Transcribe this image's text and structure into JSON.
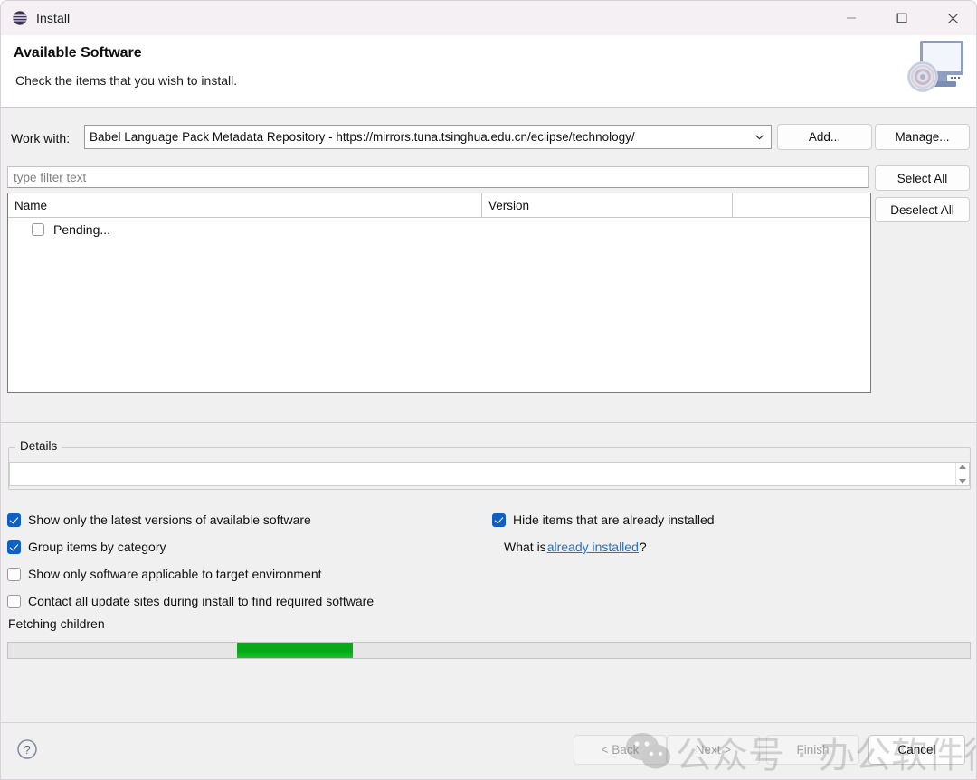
{
  "window": {
    "title": "Install",
    "icon": "eclipse-globe-icon",
    "controls": {
      "minimize": "minimize-icon",
      "maximize": "maximize-icon",
      "close": "close-icon"
    }
  },
  "header": {
    "title": "Available Software",
    "subtitle": "Check the items that you wish to install.",
    "icon": "monitor-disc-icon"
  },
  "workwith": {
    "label": "Work with:",
    "value": "Babel Language Pack Metadata Repository - https://mirrors.tuna.tsinghua.edu.cn/eclipse/technology/",
    "add_label": "Add...",
    "manage_label": "Manage..."
  },
  "filter": {
    "placeholder": "type filter text",
    "value": ""
  },
  "list_buttons": {
    "select_all": "Select All",
    "deselect_all": "Deselect All"
  },
  "table": {
    "columns": [
      "Name",
      "Version",
      ""
    ],
    "rows": [
      {
        "name": "Pending...",
        "version": "",
        "checked": false
      }
    ]
  },
  "details": {
    "legend": "Details",
    "text": ""
  },
  "options": {
    "latest_versions": {
      "label": "Show only the latest versions of available software",
      "checked": true
    },
    "group_by_category": {
      "label": "Group items by category",
      "checked": true
    },
    "target_environment": {
      "label": "Show only software applicable to target environment",
      "checked": false
    },
    "contact_sites": {
      "label": "Contact all update sites during install to find required software",
      "checked": false
    },
    "hide_installed": {
      "label": "Hide items that are already installed",
      "checked": true
    }
  },
  "whatis": {
    "prefix": "What is ",
    "link": "already installed",
    "suffix": "?"
  },
  "status": {
    "text": "Fetching children",
    "progress_percent": 12
  },
  "footer": {
    "help": "help-icon",
    "back": "< Back",
    "next": "Next >",
    "finish": "Finish",
    "cancel": "Cancel"
  },
  "watermark": {
    "text": "公众号 · 办公软件行家",
    "logo": "wechat-logo"
  },
  "colors": {
    "titlebar": "#f4f0f3",
    "body": "#f0f0f0",
    "accent_checkbox": "#0f5fc4",
    "link": "#2a6fc9",
    "progress_green": "#06a818"
  }
}
